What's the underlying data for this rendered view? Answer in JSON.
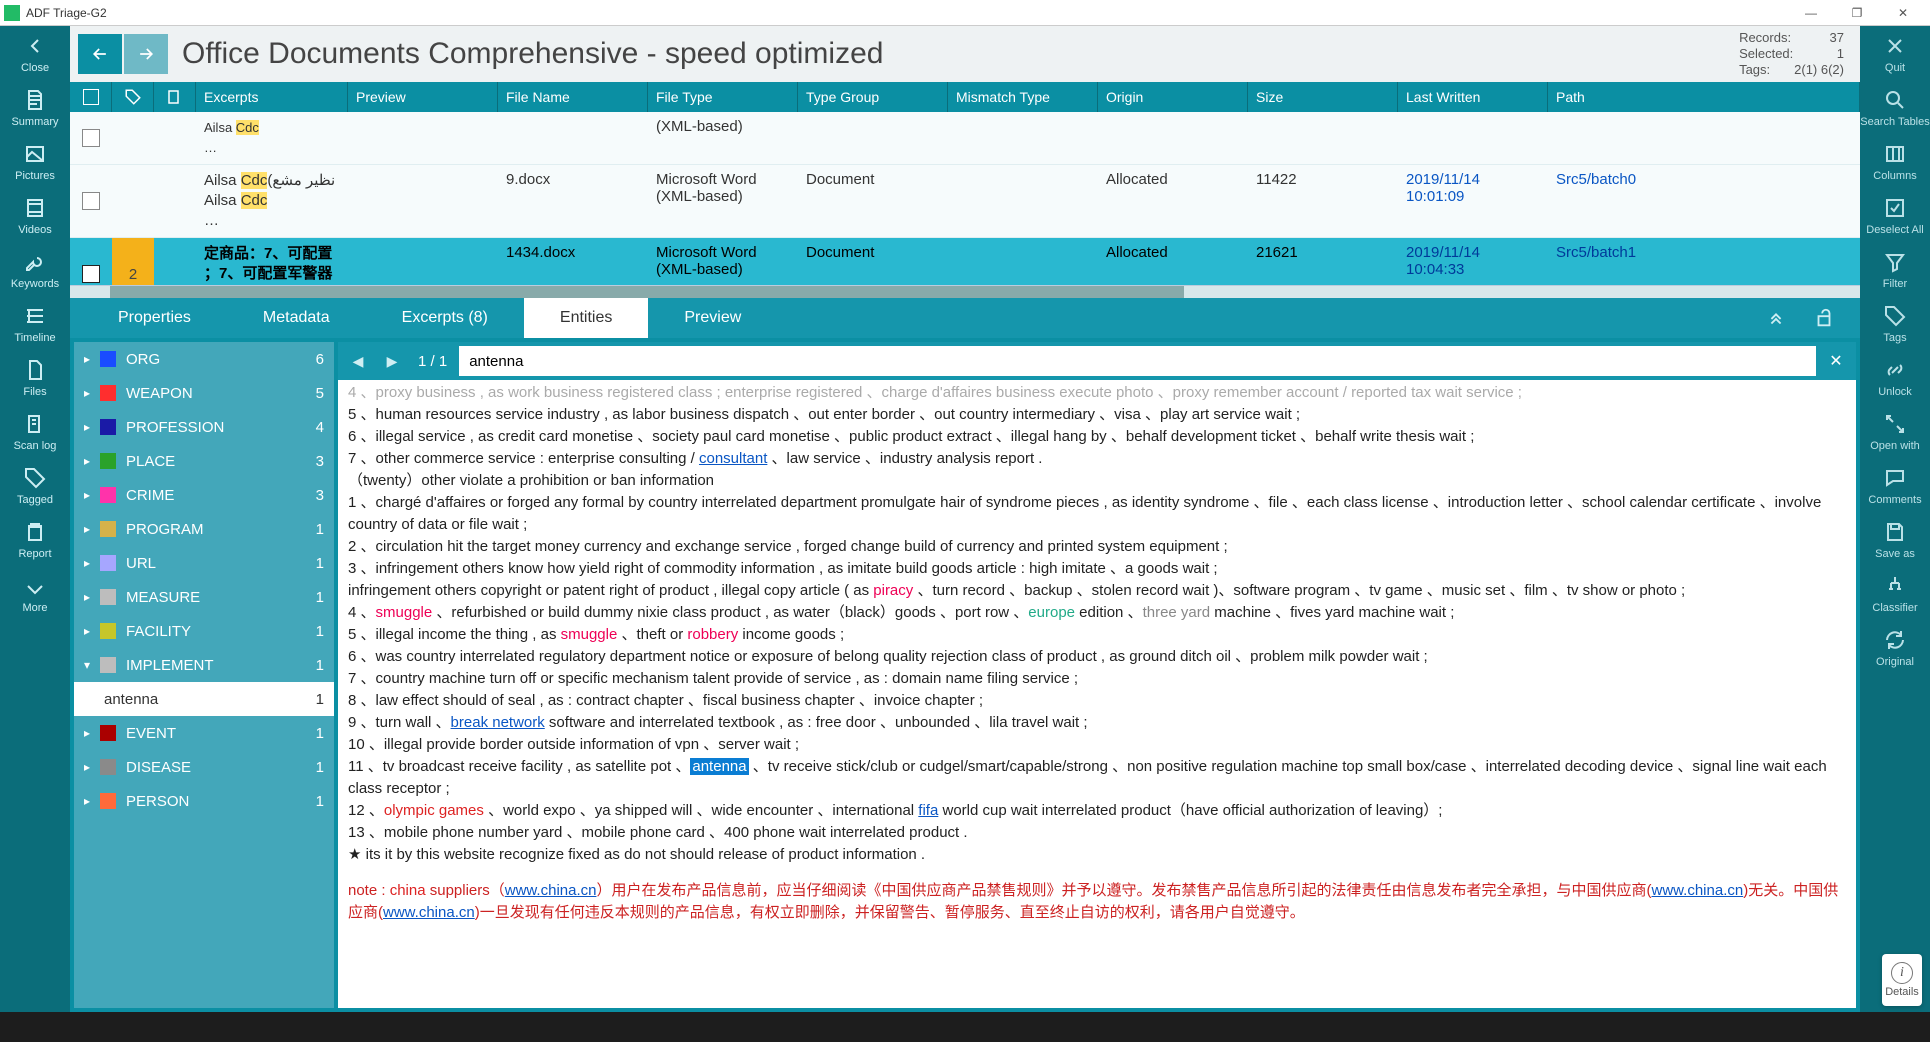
{
  "app": {
    "title": "ADF Triage-G2"
  },
  "winbtns": {
    "min": "—",
    "max": "❐",
    "close": "✕"
  },
  "left_rail": [
    {
      "name": "close",
      "label": "Close",
      "icon": "chevron-left"
    },
    {
      "name": "summary",
      "label": "Summary",
      "icon": "document"
    },
    {
      "name": "pictures",
      "label": "Pictures",
      "icon": "image"
    },
    {
      "name": "videos",
      "label": "Videos",
      "icon": "film"
    },
    {
      "name": "keywords",
      "label": "Keywords",
      "icon": "key"
    },
    {
      "name": "timeline",
      "label": "Timeline",
      "icon": "timeline"
    },
    {
      "name": "files",
      "label": "Files",
      "icon": "file"
    },
    {
      "name": "scanlog",
      "label": "Scan log",
      "icon": "scroll"
    },
    {
      "name": "tagged",
      "label": "Tagged",
      "icon": "tag"
    },
    {
      "name": "report",
      "label": "Report",
      "icon": "clipboard"
    },
    {
      "name": "more",
      "label": "More",
      "icon": "more"
    }
  ],
  "right_rail": [
    {
      "name": "quit",
      "label": "Quit",
      "icon": "close"
    },
    {
      "name": "search-tables",
      "label": "Search Tables",
      "icon": "search"
    },
    {
      "name": "columns",
      "label": "Columns",
      "icon": "columns"
    },
    {
      "name": "deselect",
      "label": "Deselect All",
      "icon": "checkbox"
    },
    {
      "name": "filter",
      "label": "Filter",
      "icon": "funnel"
    },
    {
      "name": "tags",
      "label": "Tags",
      "icon": "tag"
    },
    {
      "name": "unlock",
      "label": "Unlock",
      "icon": "link"
    },
    {
      "name": "openwith",
      "label": "Open with",
      "icon": "open"
    },
    {
      "name": "comments",
      "label": "Comments",
      "icon": "comment"
    },
    {
      "name": "saveas",
      "label": "Save as",
      "icon": "save"
    },
    {
      "name": "classifier",
      "label": "Classifier",
      "icon": "tree"
    },
    {
      "name": "original",
      "label": "Original",
      "icon": "refresh"
    }
  ],
  "header": {
    "title": "Office Documents Comprehensive - speed optimized",
    "records_label": "Records:",
    "records_val": "37",
    "selected_label": "Selected:",
    "selected_val": "1",
    "tags_label": "Tags:",
    "tags_val": "2(1) 6(2)"
  },
  "columns": [
    "Excerpts",
    "Preview",
    "File Name",
    "File Type",
    "Type Group",
    "Mismatch Type",
    "Origin",
    "Size",
    "Last Written",
    "Path"
  ],
  "rows": [
    {
      "excerpt_a": "Ailsa ",
      "excerpt_a_hl": "Cdc",
      "excerpt_a2": "",
      "ellipsis": "…",
      "ftype": "(XML-based)"
    },
    {
      "excerpt_a": "Ailsa ",
      "excerpt_a_hl": "Cdc",
      "excerpt_a2": "(نظير مشع",
      "line2_a": "Ailsa ",
      "line2_hl": "Cdc",
      "ellipsis": "…",
      "fname": "9.docx",
      "ftype": "Microsoft Word (XML-based)",
      "tgrp": "Document",
      "orig": "Allocated",
      "size": "11422",
      "lwr": "2019/11/14 10:01:09",
      "path": "Src5/batch0"
    },
    {
      "selected": true,
      "tag": "2",
      "excerpt_a": "定商品：7、可配置",
      "line2": "；7、可配置军警器材",
      "fname": "1434.docx",
      "ftype": "Microsoft Word (XML-based)",
      "tgrp": "Document",
      "orig": "Allocated",
      "size": "21621",
      "lwr": "2019/11/14 10:04:33",
      "path": "Src5/batch1"
    }
  ],
  "tabs": [
    {
      "name": "properties",
      "label": "Properties"
    },
    {
      "name": "metadata",
      "label": "Metadata"
    },
    {
      "name": "excerpts",
      "label": "Excerpts (8)"
    },
    {
      "name": "entities",
      "label": "Entities",
      "active": true
    },
    {
      "name": "preview",
      "label": "Preview"
    }
  ],
  "find": {
    "pos": "1 / 1",
    "value": "antenna",
    "close": "✕"
  },
  "entities": [
    {
      "name": "ORG",
      "color": "#1a4cff",
      "count": "6",
      "state": "closed"
    },
    {
      "name": "WEAPON",
      "color": "#ff2e2e",
      "count": "5",
      "state": "closed"
    },
    {
      "name": "PROFESSION",
      "color": "#1a1aa6",
      "count": "4",
      "state": "closed"
    },
    {
      "name": "PLACE",
      "color": "#2aa22a",
      "count": "3",
      "state": "closed"
    },
    {
      "name": "CRIME",
      "color": "#ff33aa",
      "count": "3",
      "state": "closed"
    },
    {
      "name": "PROGRAM",
      "color": "#d6b24a",
      "count": "1",
      "state": "closed"
    },
    {
      "name": "URL",
      "color": "#a6a6ff",
      "count": "1",
      "state": "closed"
    },
    {
      "name": "MEASURE",
      "color": "#bdbdbd",
      "count": "1",
      "state": "closed"
    },
    {
      "name": "FACILITY",
      "color": "#c6c62a",
      "count": "1",
      "state": "closed"
    },
    {
      "name": "IMPLEMENT",
      "color": "#bdbdbd",
      "count": "1",
      "state": "open",
      "children": [
        {
          "name": "antenna",
          "count": "1"
        }
      ]
    },
    {
      "name": "EVENT",
      "color": "#aa0000",
      "count": "1",
      "state": "closed"
    },
    {
      "name": "DISEASE",
      "color": "#8a8a8a",
      "count": "1",
      "state": "closed"
    },
    {
      "name": "PERSON",
      "color": "#ff6a3a",
      "count": "1",
      "state": "closed"
    }
  ],
  "doc_lines": [
    {
      "t": "4 、proxy business , as work business registered class ; enterprise registered 、charge d'affaires business execute photo 、proxy remember account / reported tax wait service ;",
      "faded": true
    },
    {
      "t": "5 、human resources service industry , as labor business dispatch 、out enter border 、out country intermediary 、visa 、play art service wait ;"
    },
    {
      "t": "6 、illegal service , as credit card monetise 、society paul card monetise 、public product extract 、illegal hang by 、behalf development ticket 、behalf write thesis wait ;"
    },
    {
      "pre": "7 、other commerce service : enterprise consulting / ",
      "hl": "consultant",
      "hlc": "blue",
      "post": " 、law service 、industry analysis report ."
    },
    {
      "t": "（twenty）other violate a prohibition or ban information"
    },
    {
      "t": "1 、chargé d'affaires or forged any formal by country interrelated department promulgate hair of syndrome pieces , as identity syndrome 、file 、each class license 、introduction letter 、school calendar certificate 、involve country of data or file wait ;"
    },
    {
      "t": "2 、circulation hit the target money currency and exchange service , forged change build of currency and printed system equipment ;"
    },
    {
      "t": "3 、infringement others know how yield right of commodity information , as imitate build goods article : high imitate 、a goods wait ;"
    },
    {
      "pre": "infringement others copyright or patent right of product , illegal copy article ( as ",
      "hl": "piracy",
      "hlc": "pink",
      "post": " 、turn record 、backup 、stolen record wait )、software program 、tv game 、music set 、film 、tv show or photo ;"
    },
    {
      "pre": "4 、",
      "hl": "smuggle",
      "hlc": "pink",
      "mid": " 、refurbished or build dummy nixie class product , as water（black）goods 、port row 、",
      "hl2": "europe",
      "hl2c": "green",
      "mid2": " edition 、",
      "hl3": "three yard",
      "hl3c": "grey",
      "post": " machine 、fives yard machine wait ;"
    },
    {
      "pre": "5 、illegal income the thing , as ",
      "hl": "smuggle",
      "hlc": "pink",
      "mid": " 、theft or ",
      "hl2": "robbery",
      "hl2c": "pink",
      "post": " income goods ;"
    },
    {
      "t": "6 、was country interrelated regulatory department notice or exposure of belong quality rejection class of product , as ground ditch oil 、problem milk powder wait ;"
    },
    {
      "t": "7 、country machine turn off or specific mechanism talent provide of service , as : domain name filing service ;"
    },
    {
      "t": "8 、law effect should of seal , as : contract chapter 、fiscal business chapter 、invoice chapter ;"
    },
    {
      "pre": "9 、turn wall 、",
      "hl": "break network",
      "hlc": "blue",
      "post": " software and interrelated textbook , as : free door 、unbounded 、lila travel wait ;"
    },
    {
      "t": "10 、illegal provide border outside information of vpn 、server wait ;"
    },
    {
      "pre": "11 、tv broadcast receive facility , as satellite pot 、",
      "hl": "antenna",
      "hlc": "sel",
      "post": " 、tv receive stick/club or cudgel/smart/capable/strong 、non positive regulation machine top small box/case 、interrelated decoding device 、signal line wait each class receptor ;"
    },
    {
      "pre": "12 、",
      "hl": "olympic games",
      "hlc": "red",
      "mid": " 、world expo 、ya shipped will 、wide encounter 、international ",
      "hl2": "fifa",
      "hl2c": "blue",
      "post": " world cup wait interrelated product（have official authorization of leaving）;"
    },
    {
      "t": "13 、mobile phone number yard 、mobile phone card 、400 phone wait interrelated product ."
    },
    {
      "t": "★ its it by this website recognize fixed as do not should release of product information ."
    },
    {
      "spacer": true
    },
    {
      "note": true,
      "pre": "note : ",
      "hl": "china",
      "hlc": "red",
      "mid": " suppliers（",
      "url": "www.china.cn",
      "post_cn": "）用户在发布产品信息前，应当仔细阅读《中国供应商产品禁售规则》并予以遵守。发布禁售产品信息所引起的法律责任由信息发布者完全承担，与中国供应商(",
      "url2": "www.china.cn",
      "post_cn2": ")无关。中国供应商(",
      "url3": "www.china.cn",
      "post_cn3": ")一旦发现有任何违反本规则的产品信息，有权立即删除，并保留警告、暂停服务、直至终止自访的权利，请各用户自觉遵守。"
    }
  ],
  "details_fab": "Details"
}
